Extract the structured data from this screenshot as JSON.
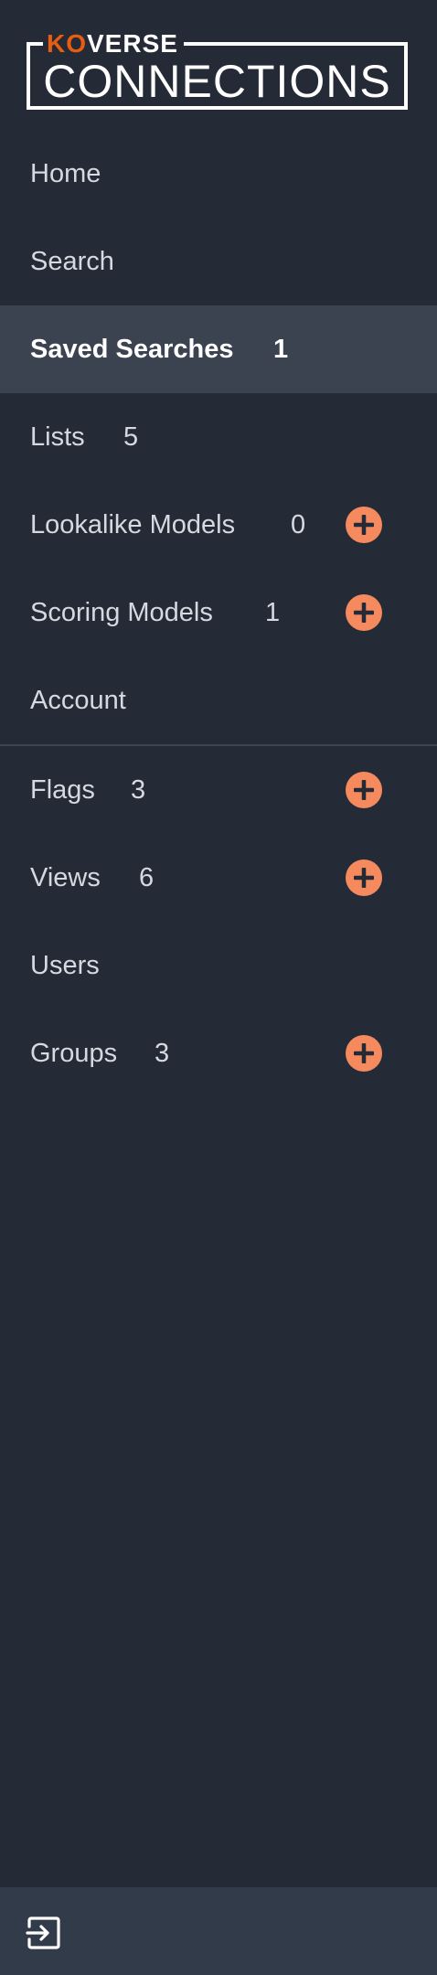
{
  "logo": {
    "top_accent": "KO",
    "top_rest": "VERSE",
    "bottom": "CONNECTIONS"
  },
  "nav": {
    "home": {
      "label": "Home"
    },
    "search": {
      "label": "Search"
    },
    "saved_searches": {
      "label": "Saved Searches",
      "count": "1"
    },
    "lists": {
      "label": "Lists",
      "count": "5"
    },
    "lookalike_models": {
      "label": "Lookalike Models",
      "count": "0"
    },
    "scoring_models": {
      "label": "Scoring Models",
      "count": "1"
    },
    "account": {
      "label": "Account"
    },
    "flags": {
      "label": "Flags",
      "count": "3"
    },
    "views": {
      "label": "Views",
      "count": "6"
    },
    "users": {
      "label": "Users"
    },
    "groups": {
      "label": "Groups",
      "count": "3"
    }
  },
  "icons": {
    "add": "plus-circle-icon",
    "logout": "logout-icon"
  },
  "colors": {
    "background": "#252b36",
    "active_background": "#3b4250",
    "footer_background": "#323b4a",
    "accent": "#f48a5e",
    "logo_accent": "#e85d10"
  }
}
